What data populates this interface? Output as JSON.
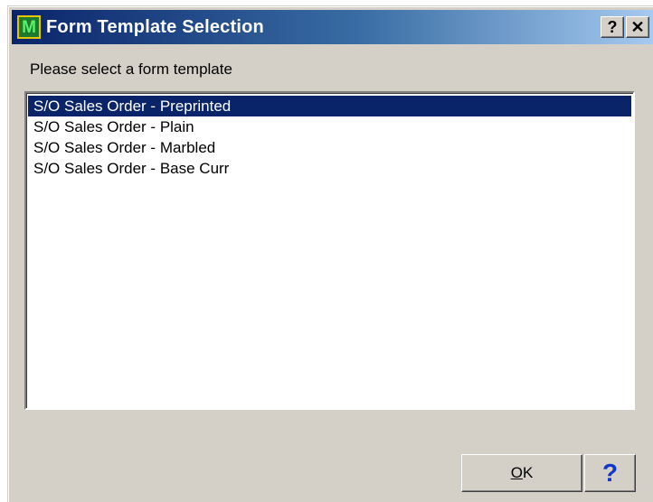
{
  "window": {
    "title": "Form Template Selection",
    "icon": "app-logo-icon",
    "icon_letter": "M",
    "help_glyph": "?",
    "close_glyph": "✕"
  },
  "prompt": "Please select a form template",
  "templates": {
    "selected_index": 0,
    "items": [
      "S/O Sales Order - Preprinted",
      "S/O Sales Order - Plain",
      "S/O Sales Order - Marbled",
      "S/O Sales Order - Base Curr"
    ]
  },
  "buttons": {
    "ok_mnemonic": "O",
    "ok_rest": "K",
    "help_glyph": "?"
  },
  "colors": {
    "selection": "#0a246a",
    "dialog_face": "#d4d0c8",
    "help_question": "#1436c8"
  }
}
